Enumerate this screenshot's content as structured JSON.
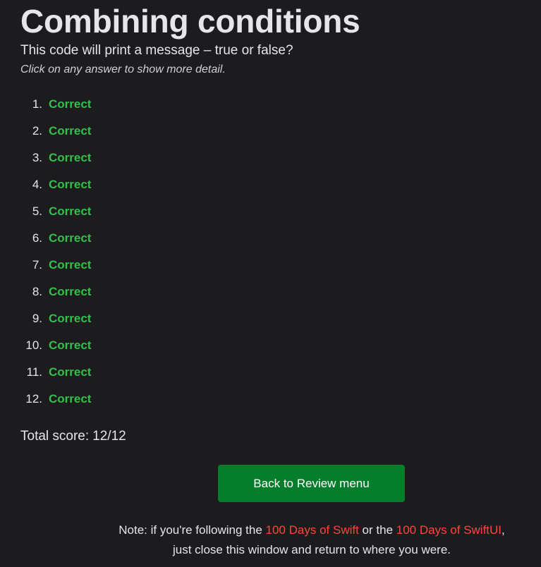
{
  "page": {
    "title": "Combining conditions",
    "subtitle": "This code will print a message – true or false?",
    "hint": "Click on any answer to show more detail."
  },
  "answers": [
    {
      "number": "1.",
      "label": "Correct"
    },
    {
      "number": "2.",
      "label": "Correct"
    },
    {
      "number": "3.",
      "label": "Correct"
    },
    {
      "number": "4.",
      "label": "Correct"
    },
    {
      "number": "5.",
      "label": "Correct"
    },
    {
      "number": "6.",
      "label": "Correct"
    },
    {
      "number": "7.",
      "label": "Correct"
    },
    {
      "number": "8.",
      "label": "Correct"
    },
    {
      "number": "9.",
      "label": "Correct"
    },
    {
      "number": "10.",
      "label": "Correct"
    },
    {
      "number": "11.",
      "label": "Correct"
    },
    {
      "number": "12.",
      "label": "Correct"
    }
  ],
  "score": {
    "label": "Total score:",
    "value": "12/12"
  },
  "back_button": {
    "label": "Back to Review menu"
  },
  "note": {
    "prefix": "Note: if you're following the ",
    "link1": "100 Days of Swift",
    "middle": " or the ",
    "link2": "100 Days of SwiftUI",
    "suffix": ", just close this window and return to where you were."
  },
  "colors": {
    "background": "#1c1c1e",
    "correct": "#30c14a",
    "button": "#067d2a",
    "link": "#ff453a"
  }
}
